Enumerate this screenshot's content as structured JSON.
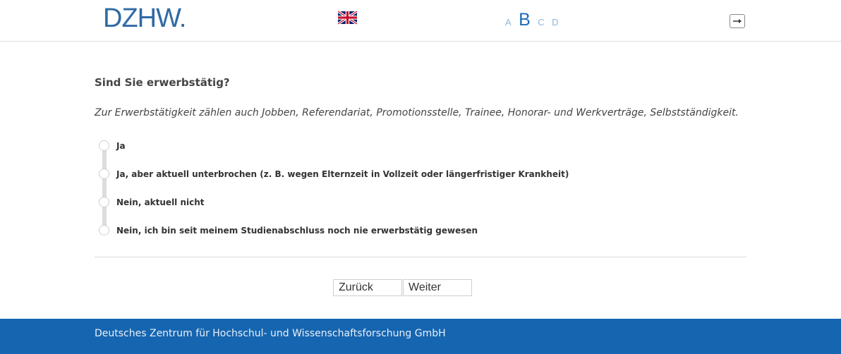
{
  "header": {
    "logo_text": "DZHW",
    "logo_dot": ".",
    "language_icon": "uk-flag-icon",
    "font_sizes": [
      "A",
      "B",
      "C",
      "D"
    ],
    "exit_icon": "exit-arrow-icon",
    "colors": {
      "logo": "#2f6aa6",
      "active_font_size": "#1f6db8",
      "inactive_font_size": "#8fb6da"
    }
  },
  "question": {
    "title": "Sind Sie erwerbstätig?",
    "instruction": "Zur Erwerbstätigkeit zählen auch Jobben, Referendariat, Promotionsstelle, Trainee, Honorar- und Werkverträge, Selbstständigkeit.",
    "options": [
      {
        "label": "Ja",
        "selected": false
      },
      {
        "label": "Ja, aber aktuell unterbrochen (z.  B. wegen Elternzeit in Vollzeit oder längerfristiger Krankheit)",
        "selected": false
      },
      {
        "label": "Nein, aktuell nicht",
        "selected": false
      },
      {
        "label": "Nein, ich bin seit meinem Studienabschluss noch nie erwerbstätig gewesen",
        "selected": false
      }
    ]
  },
  "navigation": {
    "back_label": "Zurück",
    "next_label": "Weiter"
  },
  "footer": {
    "text": "Deutsches Zentrum für Hochschul- und Wissenschaftsforschung GmbH",
    "color": "#1565b0"
  }
}
